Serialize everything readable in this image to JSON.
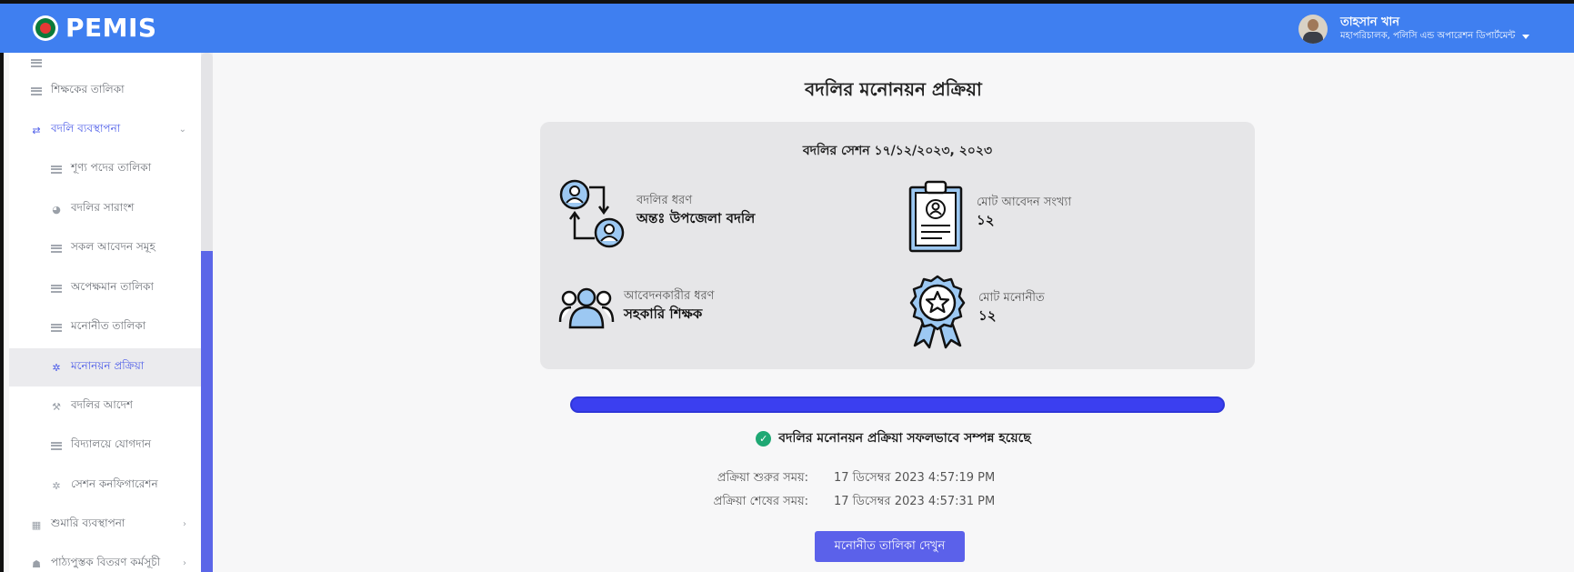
{
  "brand": {
    "name": "PEMIS"
  },
  "user": {
    "name": "তাহসান খান",
    "role": "মহাপরিচালক, পলিসি এন্ড অপারেশন ডিপার্টমেন্ট"
  },
  "sidebar": {
    "items": [
      {
        "label": "শিক্ষকের তালিকা"
      },
      {
        "label": "বদলি ব্যবস্থাপনা"
      },
      {
        "label": "শূণ্য পদের তালিকা"
      },
      {
        "label": "বদলির সারাংশ"
      },
      {
        "label": "সকল আবেদন সমূহ"
      },
      {
        "label": "অপেক্ষমান তালিকা"
      },
      {
        "label": "মনোনীত তালিকা"
      },
      {
        "label": "মনোনয়ন প্রক্রিয়া"
      },
      {
        "label": "বদলির আদেশ"
      },
      {
        "label": "বিদ্যালয়ে যোগদান"
      },
      {
        "label": "সেশন কনফিগারেশন"
      },
      {
        "label": "শুমারি ব্যবস্থাপনা"
      },
      {
        "label": "পাঠ্যপুস্তক বিতরণ কর্মসূচী"
      }
    ]
  },
  "main": {
    "title": "বদলির মনোনয়ন প্রক্রিয়া",
    "session_title": "বদলির সেশন ১৭/১২/২০২৩, ২০২৩",
    "stats": {
      "transfer_type_label": "বদলির ধরণ",
      "transfer_type_value": "অন্তঃ উপজেলা বদলি",
      "total_applications_label": "মোট আবেদন সংখ্যা",
      "total_applications_value": "১২",
      "applicant_type_label": "আবেদনকারীর ধরণ",
      "applicant_type_value": "সহকারি শিক্ষক",
      "total_nominated_label": "মোট মনোনীত",
      "total_nominated_value": "১২"
    },
    "progress": 1.0,
    "success_message": "বদলির মনোনয়ন প্রক্রিয়া সফলভাবে সম্পন্ন হয়েছে",
    "start_label": "প্রক্রিয়া শুরুর সময়:",
    "start_value": "17 ডিসেম্বর 2023 4:57:19 PM",
    "end_label": "প্রক্রিয়া শেষের সময়:",
    "end_value": "17 ডিসেম্বর 2023 4:57:31 PM",
    "button_label": "মনোনীত তালিকা দেখুন"
  },
  "colors": {
    "topbar": "#3f7ff0",
    "accent": "#4a5ae8",
    "success": "#1fa874",
    "progress": "#3b3ff0"
  }
}
